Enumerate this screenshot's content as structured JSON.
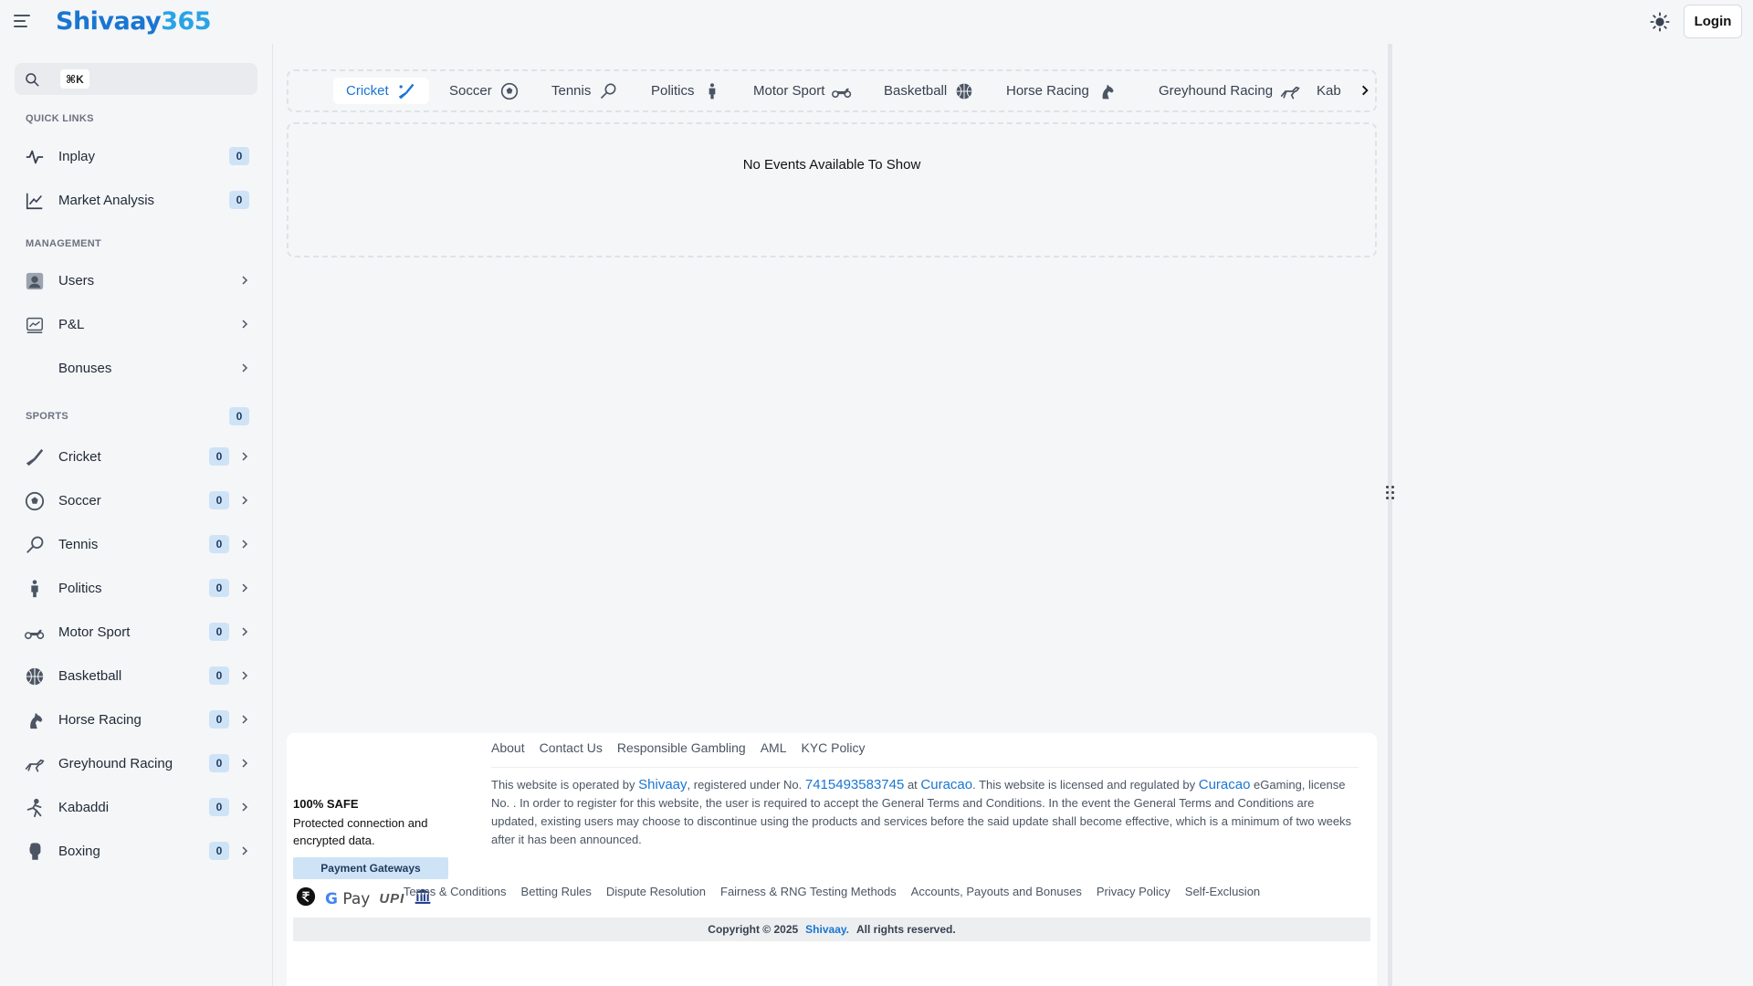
{
  "header": {
    "logo_prefix": "Shivaay",
    "logo_suffix": "365",
    "login_label": "Login"
  },
  "sidebar": {
    "search": {
      "placeholder": "",
      "shortcut": "⌘K"
    },
    "quick_links_label": "QUICK LINKS",
    "quick_links": [
      {
        "label": "Inplay",
        "count": "0",
        "icon": "pulse-icon"
      },
      {
        "label": "Market Analysis",
        "count": "0",
        "icon": "line-chart-icon"
      }
    ],
    "management_label": "MANAGEMENT",
    "management": [
      {
        "label": "Users",
        "icon": "user-icon"
      },
      {
        "label": "P&L",
        "icon": "pnl-icon"
      },
      {
        "label": "Bonuses",
        "icon": ""
      }
    ],
    "sports_label": "SPORTS",
    "sports_count": "0",
    "sports": [
      {
        "label": "Cricket",
        "count": "0",
        "icon": "cricket-icon"
      },
      {
        "label": "Soccer",
        "count": "0",
        "icon": "soccer-icon"
      },
      {
        "label": "Tennis",
        "count": "0",
        "icon": "tennis-icon"
      },
      {
        "label": "Politics",
        "count": "0",
        "icon": "politics-icon"
      },
      {
        "label": "Motor Sport",
        "count": "0",
        "icon": "motorbike-icon"
      },
      {
        "label": "Basketball",
        "count": "0",
        "icon": "basketball-icon"
      },
      {
        "label": "Horse Racing",
        "count": "0",
        "icon": "horse-icon"
      },
      {
        "label": "Greyhound Racing",
        "count": "0",
        "icon": "greyhound-icon"
      },
      {
        "label": "Kabaddi",
        "count": "0",
        "icon": "kabaddi-icon"
      },
      {
        "label": "Boxing",
        "count": "0",
        "icon": "boxing-glove-icon"
      }
    ]
  },
  "tabs": [
    {
      "label": "Cricket",
      "active": true
    },
    {
      "label": "Soccer"
    },
    {
      "label": "Tennis"
    },
    {
      "label": "Politics"
    },
    {
      "label": "Motor Sport"
    },
    {
      "label": "Basketball"
    },
    {
      "label": "Horse Racing"
    },
    {
      "label": "Greyhound Racing"
    },
    {
      "label": "Kab"
    }
  ],
  "events": {
    "empty_message": "No Events Available To Show"
  },
  "footer": {
    "top_links": [
      "About",
      "Contact Us",
      "Responsible Gambling",
      "AML",
      "KYC Policy"
    ],
    "license": {
      "p1": "This website is operated by ",
      "operator": "Shivaay",
      "p2": ", registered under No. ",
      "reg_no": "7415493583745",
      "p3": " at ",
      "jurisdiction": "Curacao",
      "p4": ". This website is licensed and regulated by ",
      "regulator": "Curacao",
      "p5": " eGaming, license No. . In order to register for this website, the user is required to accept the General Terms and Conditions. In the event the General Terms and Conditions are updated, existing users may choose to discontinue using the products and services before the said update shall become effective, which is a minimum of two weeks after it has been announced."
    },
    "safe_title": "100% SAFE",
    "safe_text": "Protected connection and encrypted data.",
    "payment_label": "Payment Gateways",
    "gpay_g": "G",
    "gpay_text": "Pay",
    "upi_text": "UPI",
    "bottom_links": [
      "Terms & Conditions",
      "Betting Rules",
      "Dispute Resolution",
      "Fairness & RNG Testing Methods",
      "Accounts, Payouts and Bonuses",
      "Privacy Policy",
      "Self-Exclusion"
    ],
    "copyright_prefix": "Copyright © 2025",
    "copyright_brand": "Shivaay.",
    "copyright_suffix": "All rights reserved."
  }
}
